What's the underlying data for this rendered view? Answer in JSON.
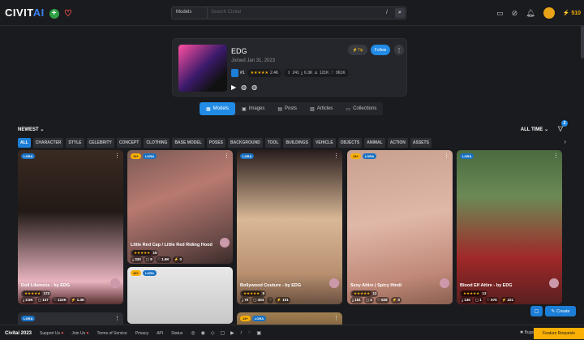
{
  "header": {
    "logo_main": "CIVIT",
    "logo_ai": "AI",
    "search_type": "Models",
    "search_placeholder": "Search Civitai",
    "search_kbd": "/",
    "buzz_amount": "510"
  },
  "profile": {
    "username": "EDG",
    "joined": "Joined Jan 31, 2023",
    "tip_label": "Tip",
    "follow_label": "Follow",
    "rank": "#1",
    "rating_count": "2.4K",
    "stat_uploads": "241",
    "stat_downloads": "6.3K",
    "stat_followers": "121K",
    "stat_likes": "961K"
  },
  "tabs": [
    {
      "label": "Models",
      "active": true
    },
    {
      "label": "Images"
    },
    {
      "label": "Posts"
    },
    {
      "label": "Articles"
    },
    {
      "label": "Collections"
    }
  ],
  "sort": {
    "label": "NEWEST",
    "period": "ALL TIME",
    "filter_count": "2"
  },
  "chips": [
    "ALL",
    "CHARACTER",
    "STYLE",
    "CELEBRITY",
    "CONCEPT",
    "CLOTHING",
    "BASE MODEL",
    "POSES",
    "BACKGROUND",
    "TOOL",
    "BUILDINGS",
    "VEHICLE",
    "OBJECTS",
    "ANIMAL",
    "ACTION",
    "ASSETS"
  ],
  "cards": [
    {
      "title": "Doll Likeness - by EDG",
      "type": "LORA",
      "rating_count": "173",
      "downloads": "3.5K",
      "comments": "137",
      "likes": "122K",
      "buzz": "1.3K"
    },
    {
      "title": "Little Red Cap / Little Red Riding Hood",
      "type": "LORA",
      "age": "13+",
      "rating_count": "15",
      "downloads": "333",
      "comments": "8",
      "likes": "1.9K",
      "buzz": "0"
    },
    {
      "title": "Bollywood Couture - by EDG",
      "type": "LORA",
      "rating_count": "9",
      "downloads": "70",
      "comments": "404",
      "likes": "",
      "buzz": "101"
    },
    {
      "title": "Sexy Attire | Spicy Hindi",
      "type": "LORA",
      "age": "13+",
      "rating_count": "12",
      "downloads": "151",
      "comments": "4",
      "likes": "626",
      "buzz": "0"
    },
    {
      "title": "Blood Elf Attire - by EDG",
      "type": "LORA",
      "rating_count": "13",
      "downloads": "136",
      "comments": "1",
      "likes": "576",
      "buzz": "221"
    },
    {
      "type": "LORA",
      "age": "13+"
    },
    {
      "type": "LORA"
    },
    {
      "type": "LORA",
      "age": "13+"
    }
  ],
  "fab": {
    "create_label": "Create"
  },
  "footer": {
    "brand": "Civitai 2023",
    "links": [
      "Support Us",
      "Join Us",
      "Terms of Service",
      "Privacy",
      "API",
      "Status"
    ],
    "bugs": "Bugs",
    "feature": "Feature Requests"
  }
}
